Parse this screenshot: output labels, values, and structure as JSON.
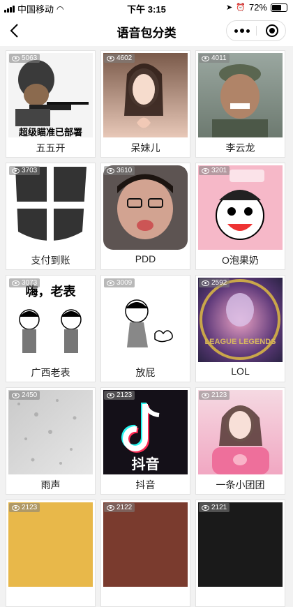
{
  "status_bar": {
    "carrier": "中国移动",
    "time": "下午 3:15",
    "battery": "72%",
    "battery_level": 0.72
  },
  "nav": {
    "title": "语音包分类"
  },
  "items": [
    {
      "name": "五五开",
      "views": "5063",
      "caption": "超级瞄准已部署"
    },
    {
      "name": "呆妹儿",
      "views": "4602"
    },
    {
      "name": "李云龙",
      "views": "4011"
    },
    {
      "name": "支付到账",
      "views": "3703"
    },
    {
      "name": "PDD",
      "views": "3610"
    },
    {
      "name": "O泡果奶",
      "views": "3201"
    },
    {
      "name": "广西老表",
      "views": "3073",
      "caption": "嗨，老表"
    },
    {
      "name": "放屁",
      "views": "3009"
    },
    {
      "name": "LOL",
      "views": "2592",
      "caption": "LEAGUE LEGENDS"
    },
    {
      "name": "雨声",
      "views": "2450"
    },
    {
      "name": "抖音",
      "views": "2123",
      "caption": "抖音"
    },
    {
      "name": "一条小团团",
      "views": "2123"
    },
    {
      "name": "",
      "views": "2123"
    },
    {
      "name": "",
      "views": "2122"
    },
    {
      "name": "",
      "views": "2121"
    }
  ]
}
